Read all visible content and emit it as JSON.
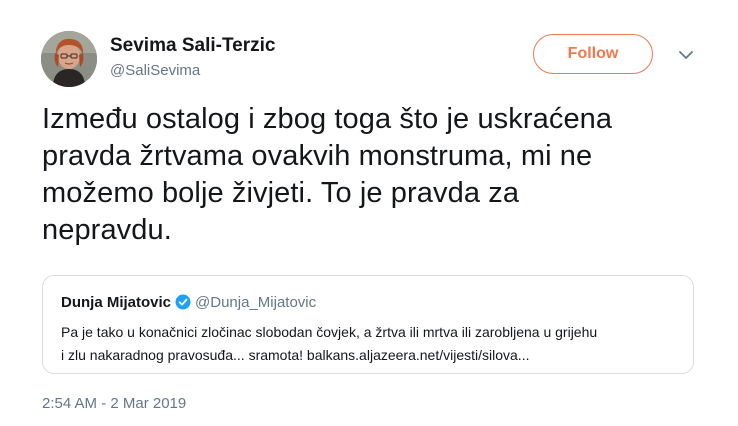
{
  "author": {
    "name": "Sevima Sali-Terzic",
    "handle": "@SaliSevima"
  },
  "follow_label": "Follow",
  "tweet": {
    "line1": "Između ostalog i zbog toga što je uskraćena",
    "line2": "pravda žrtvama ovakvih monstruma, mi ne",
    "line3": "možemo bolje živjeti. To je pravda za",
    "line4": "nepravdu."
  },
  "quoted": {
    "name": "Dunja Mijatovic",
    "handle": "@Dunja_Mijatovic",
    "line1": "Pa je tako u konačnici zločinac slobodan čovjek, a žrtva ili mrtva ili zarobljena u grijehu",
    "line2": "i zlu nakaradnog pravosuđa... sramota!  balkans.aljazeera.net/vijesti/silova..."
  },
  "timestamp": "2:54 AM - 2 Mar 2019",
  "icons": {
    "menu": "chevron-down-icon",
    "verified": "verified-badge-icon"
  },
  "colors": {
    "follow_accent": "#f0784e",
    "verified": "#1da1f2",
    "secondary_text": "#657786"
  }
}
